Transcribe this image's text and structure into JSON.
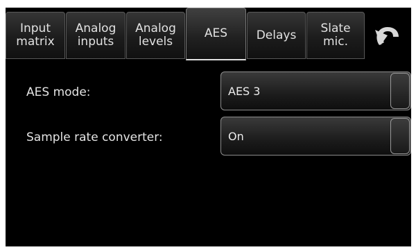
{
  "tabs": [
    {
      "label": "Input\nmatrix"
    },
    {
      "label": "Analog\ninputs"
    },
    {
      "label": "Analog\nlevels"
    },
    {
      "label": "AES"
    },
    {
      "label": "Delays"
    },
    {
      "label": "Slate\nmic."
    }
  ],
  "active_tab": "AES",
  "back_icon": "undo-arrow-icon",
  "settings": {
    "aes_mode": {
      "label": "AES mode:",
      "value": "AES 3"
    },
    "src": {
      "label": "Sample rate converter:",
      "value": "On"
    }
  }
}
